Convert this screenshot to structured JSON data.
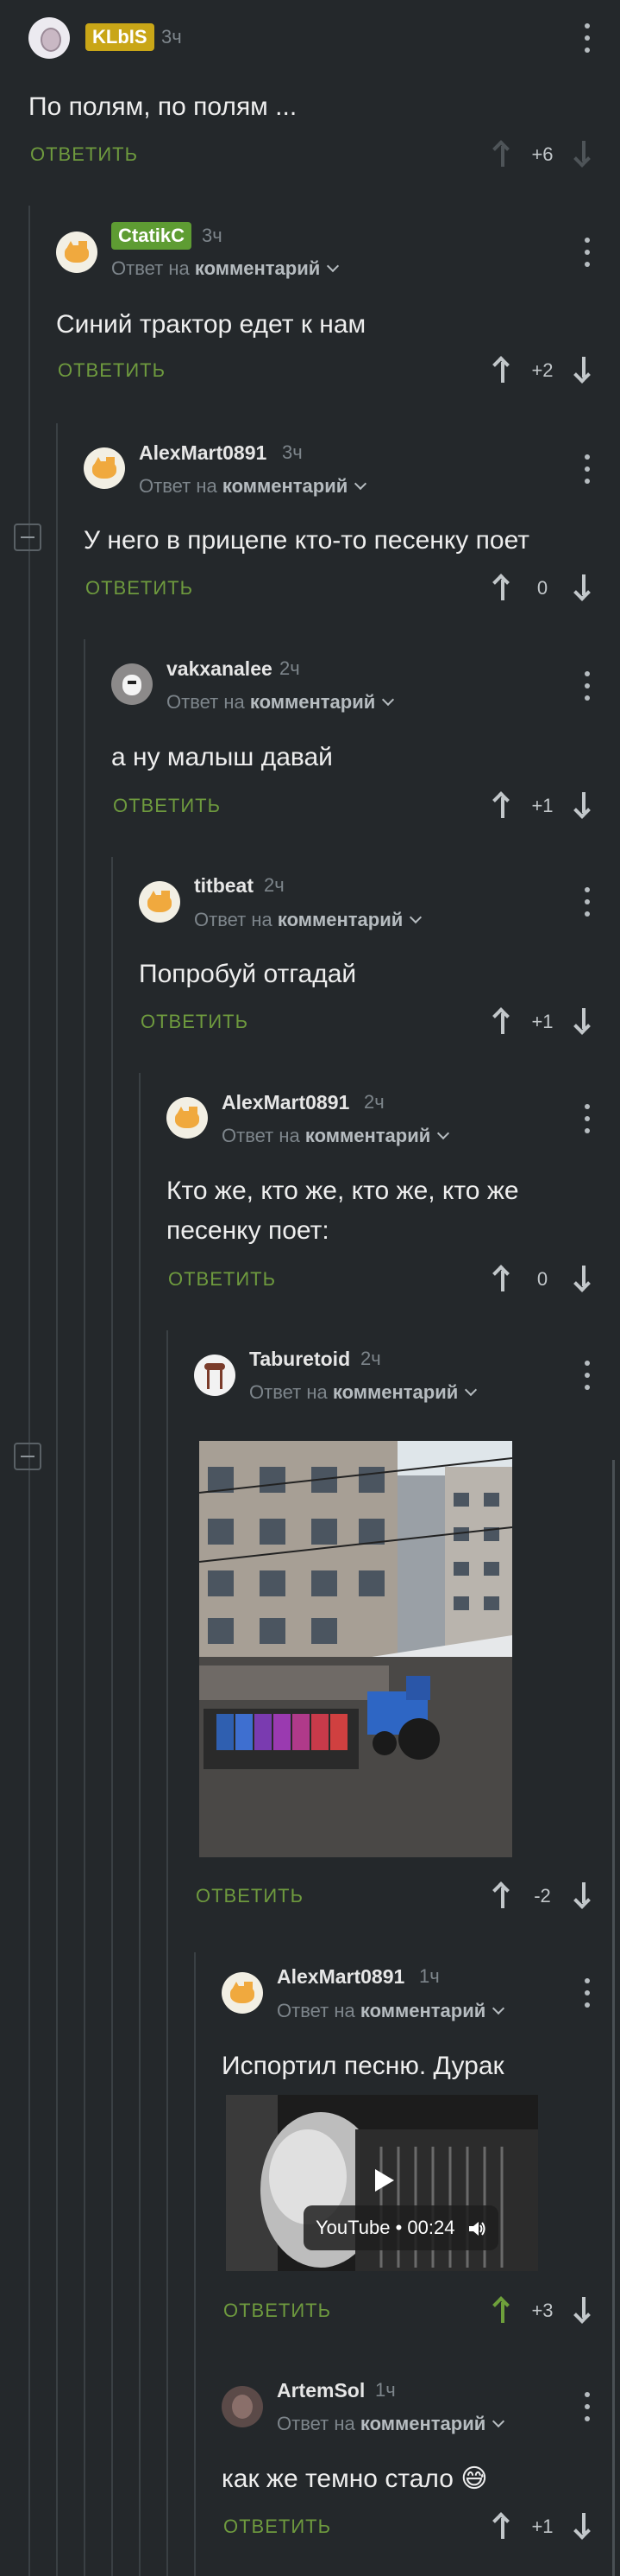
{
  "comments": [
    {
      "id": "c1",
      "author": "KLbIS",
      "author_badge_color": "#c9a617",
      "time": "3ч",
      "text": "По полям, по полям ...",
      "reply_label": "ОТВЕТИТЬ",
      "score": "+6"
    },
    {
      "id": "c2",
      "author": "CtatikC",
      "author_badge_color": "#5e9c33",
      "time": "3ч",
      "reply_to": "Ответ на",
      "reply_to_target": "комментарий",
      "text": "Синий трактор едет к нам",
      "reply_label": "ОТВЕТИТЬ",
      "score": "+2"
    },
    {
      "id": "c3",
      "author": "AlexMart0891",
      "time": "3ч",
      "reply_to": "Ответ на",
      "reply_to_target": "комментарий",
      "text": "У него в прицепе кто-то песенку поет",
      "reply_label": "ОТВЕТИТЬ",
      "score": "0"
    },
    {
      "id": "c4",
      "author": "vakxanalee",
      "time": "2ч",
      "reply_to": "Ответ на",
      "reply_to_target": "комментарий",
      "text": "а ну малыш давай",
      "reply_label": "ОТВЕТИТЬ",
      "score": "+1"
    },
    {
      "id": "c5",
      "author": "titbeat",
      "time": "2ч",
      "reply_to": "Ответ на",
      "reply_to_target": "комментарий",
      "text": "Попробуй отгадай",
      "reply_label": "ОТВЕТИТЬ",
      "score": "+1"
    },
    {
      "id": "c6",
      "author": "AlexMart0891",
      "time": "2ч",
      "reply_to": "Ответ на",
      "reply_to_target": "комментарий",
      "text_line1": "Кто же, кто же, кто же, кто же",
      "text_line2": "песенку поет:",
      "reply_label": "ОТВЕТИТЬ",
      "score": "0"
    },
    {
      "id": "c7",
      "author": "Taburetoid",
      "time": "2ч",
      "reply_to": "Ответ на",
      "reply_to_target": "комментарий",
      "reply_label": "ОТВЕТИТЬ",
      "score": "-2"
    },
    {
      "id": "c8",
      "author": "AlexMart0891",
      "time": "1ч",
      "reply_to": "Ответ на",
      "reply_to_target": "комментарий",
      "text": "Испортил песню. Дурак",
      "video_label": "YouTube • 00:24",
      "reply_label": "ОТВЕТИТЬ",
      "score": "+3"
    },
    {
      "id": "c9",
      "author": "ArtemSol",
      "time": "1ч",
      "reply_to": "Ответ на",
      "reply_to_target": "комментарий",
      "text": "как же темно стало 😅",
      "reply_label": "ОТВЕТИТЬ",
      "score": "+1"
    }
  ],
  "icons": {
    "more": "kebab-icon",
    "upvote": "arrow-up-icon",
    "downvote": "arrow-down-icon",
    "collapse": "collapse-icon",
    "play": "play-icon",
    "sound": "speaker-icon"
  },
  "colors": {
    "background": "#24282b",
    "accent_green": "#6e9a3e",
    "upvoted": "#6ea03b"
  }
}
